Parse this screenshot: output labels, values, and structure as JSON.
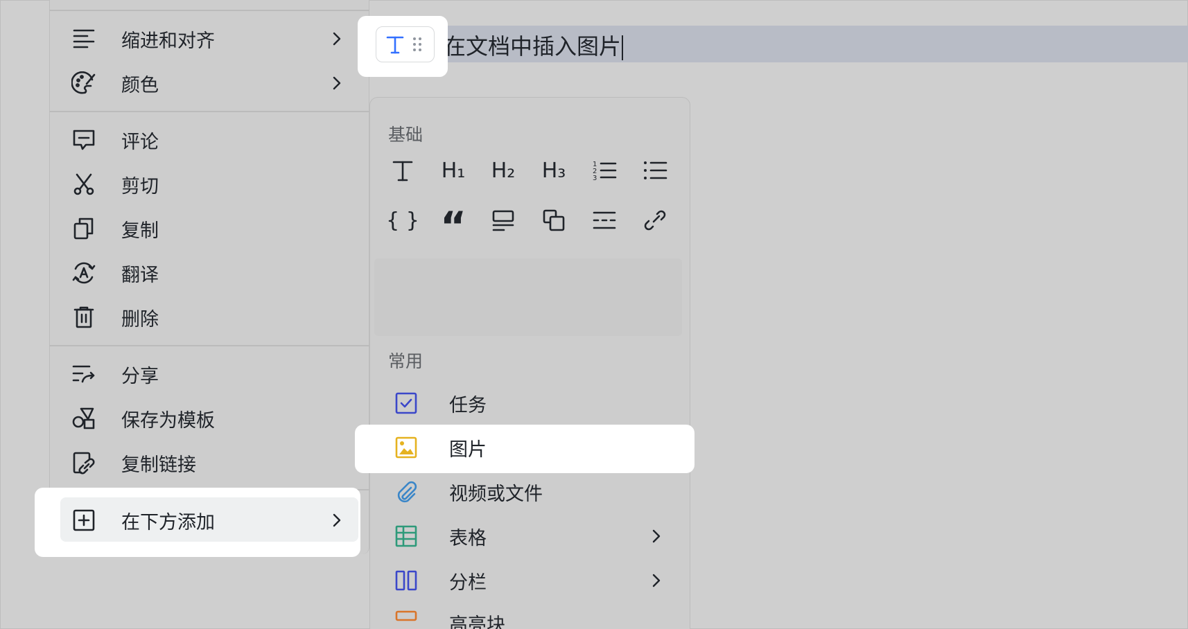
{
  "context_menu": {
    "items": [
      {
        "label": "缩进和对齐",
        "icon": "indent-align-icon"
      },
      {
        "label": "颜色",
        "icon": "palette-icon"
      },
      {
        "label": "评论",
        "icon": "comment-icon"
      },
      {
        "label": "剪切",
        "icon": "scissors-icon"
      },
      {
        "label": "复制",
        "icon": "copy-icon"
      },
      {
        "label": "翻译",
        "icon": "translate-icon"
      },
      {
        "label": "删除",
        "icon": "trash-icon"
      },
      {
        "label": "分享",
        "icon": "share-icon"
      },
      {
        "label": "保存为模板",
        "icon": "template-icon"
      },
      {
        "label": "复制链接",
        "icon": "copy-link-icon"
      },
      {
        "label": "在下方添加",
        "icon": "add-below-icon"
      }
    ]
  },
  "document": {
    "line_text": "在文档中插入图片",
    "block_type_icon": "text-type-icon"
  },
  "insert_panel": {
    "basic_title": "基础",
    "basic_items": [
      "T",
      "H1",
      "H2",
      "H3",
      "ordered-list",
      "bullet-list",
      "code-block",
      "quote",
      "callout",
      "sync-block",
      "divider",
      "link"
    ],
    "h1_glyph": "H₁",
    "h2_glyph": "H₂",
    "h3_glyph": "H₃",
    "code_glyph": "{ }",
    "quote_glyph": "“",
    "common_title": "常用",
    "common_items": [
      {
        "label": "任务",
        "icon": "task-checkbox-icon",
        "color": "#3b47c9"
      },
      {
        "label": "图片",
        "icon": "image-icon",
        "color": "#e5b220"
      },
      {
        "label": "视频或文件",
        "icon": "paperclip-icon",
        "color": "#3a86c8"
      },
      {
        "label": "表格",
        "icon": "table-icon",
        "color": "#2e9a7a"
      },
      {
        "label": "分栏",
        "icon": "columns-icon",
        "color": "#3b47c9"
      },
      {
        "label": "高亮块",
        "icon": "highlight-block-icon",
        "color": "#d9752a"
      }
    ]
  },
  "colors": {
    "accent_blue": "#3370ff",
    "backdrop": "#cfcfcf",
    "selection": "#b8bcc6"
  }
}
